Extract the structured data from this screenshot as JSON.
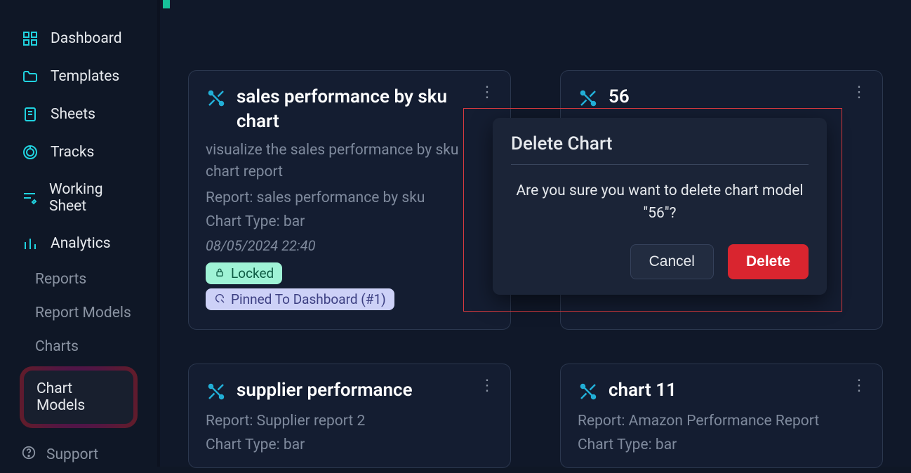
{
  "sidebar": {
    "items": [
      {
        "label": "Dashboard"
      },
      {
        "label": "Templates"
      },
      {
        "label": "Sheets"
      },
      {
        "label": "Tracks"
      },
      {
        "label": "Working Sheet"
      },
      {
        "label": "Analytics"
      }
    ],
    "sub_items": [
      {
        "label": "Reports"
      },
      {
        "label": "Report Models"
      },
      {
        "label": "Charts"
      }
    ],
    "chart_models_label": "Chart Models",
    "support_label": "Support"
  },
  "cards": [
    {
      "title": "sales performance by sku chart",
      "desc": "visualize the sales performance by sku chart report",
      "report_label": "Report: sales performance by sku",
      "type_label": "Chart Type: bar",
      "date": "08/05/2024 22:40",
      "lock_label": "Locked",
      "pin_label": "Pinned To Dashboard (#1)"
    },
    {
      "title": "56"
    },
    {
      "title": "supplier performance",
      "report_label": "Report: Supplier report 2",
      "type_label": "Chart Type: bar"
    },
    {
      "title": "chart 11",
      "report_label": "Report: Amazon Performance Report",
      "type_label": "Chart Type: bar"
    }
  ],
  "dialog": {
    "title": "Delete Chart",
    "body_prefix": "Are you sure you want to delete chart model ",
    "body_target": "\"56\"",
    "body_suffix": "?",
    "cancel": "Cancel",
    "delete": "Delete"
  }
}
